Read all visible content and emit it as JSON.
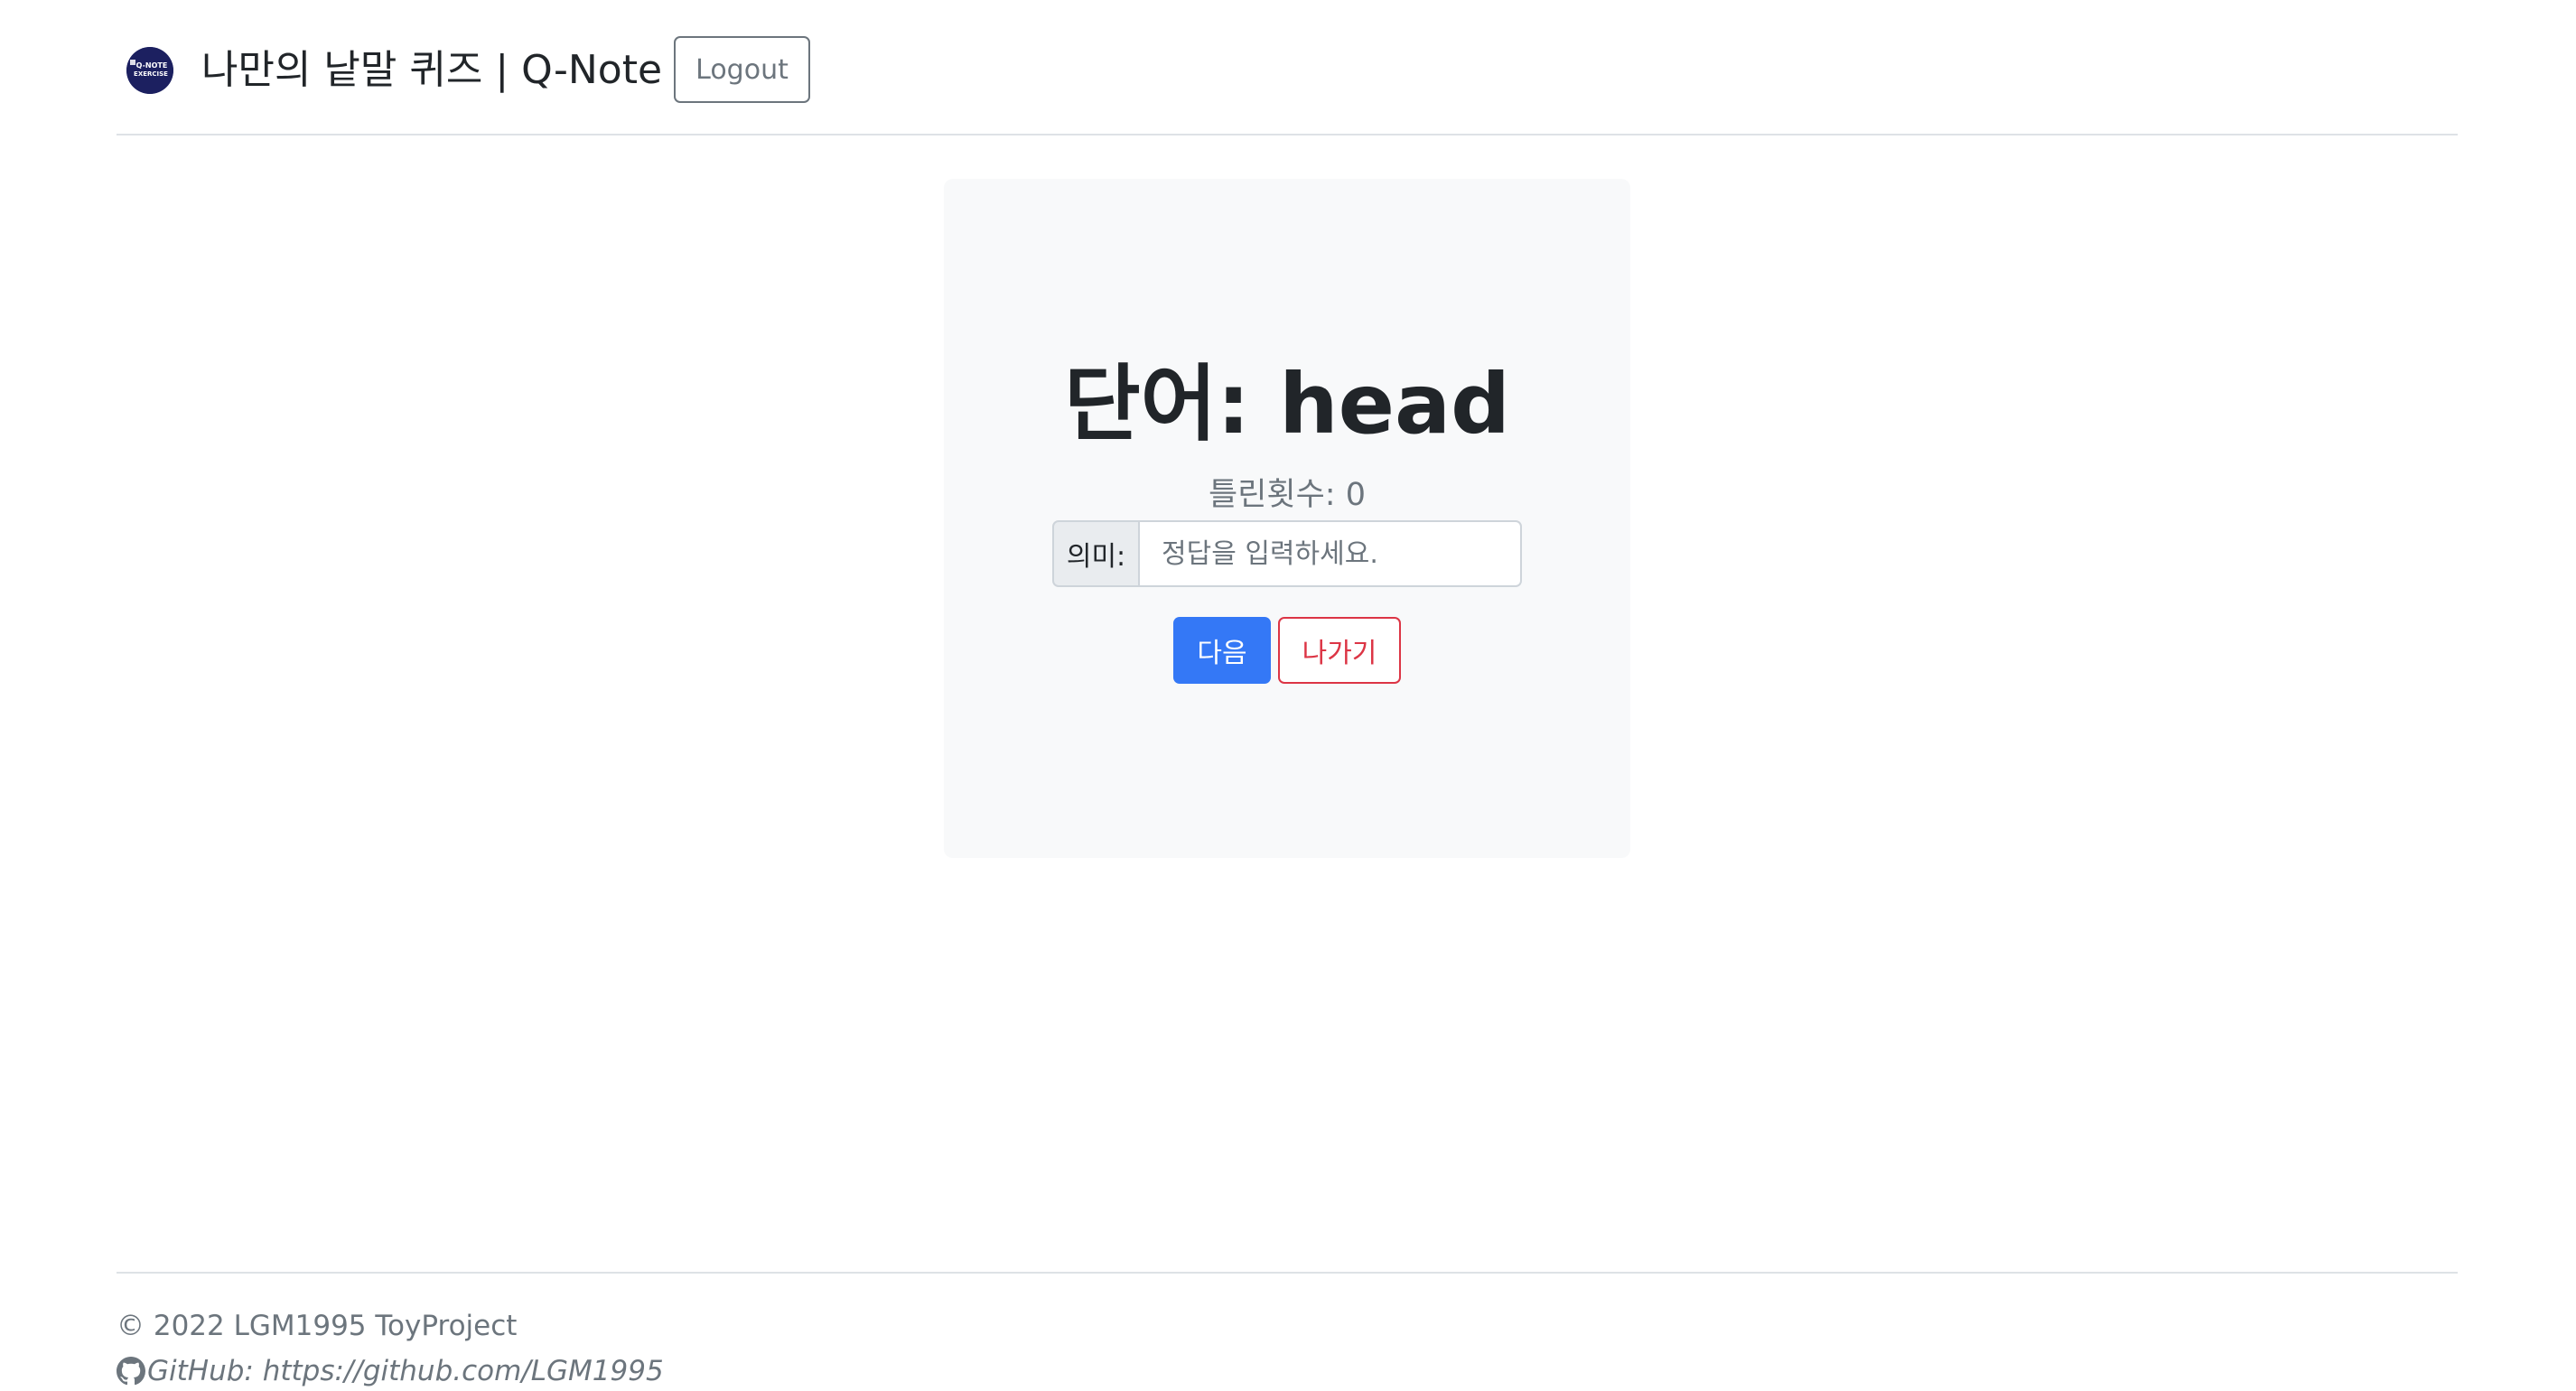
{
  "header": {
    "logo_text_line1": "Q-NOTE",
    "logo_text_line2": "EXERCISE",
    "title": "나만의 낱말 퀴즈 | Q-Note",
    "logout_label": "Logout"
  },
  "quiz": {
    "word_heading": "단어: head",
    "wrong_count": "틀린횟수: 0",
    "meaning_label": "의미:",
    "answer_placeholder": "정답을 입력하세요.",
    "answer_value": "",
    "next_label": "다음",
    "exit_label": "나가기"
  },
  "footer": {
    "copyright": "© 2022 LGM1995 ToyProject",
    "github": "GitHub: https://github.com/LGM1995"
  },
  "colors": {
    "primary": "#3478f6",
    "danger": "#dc3545",
    "secondary": "#6c757d",
    "card_bg": "#f8f9fa",
    "logo_bg": "#1c2060"
  }
}
